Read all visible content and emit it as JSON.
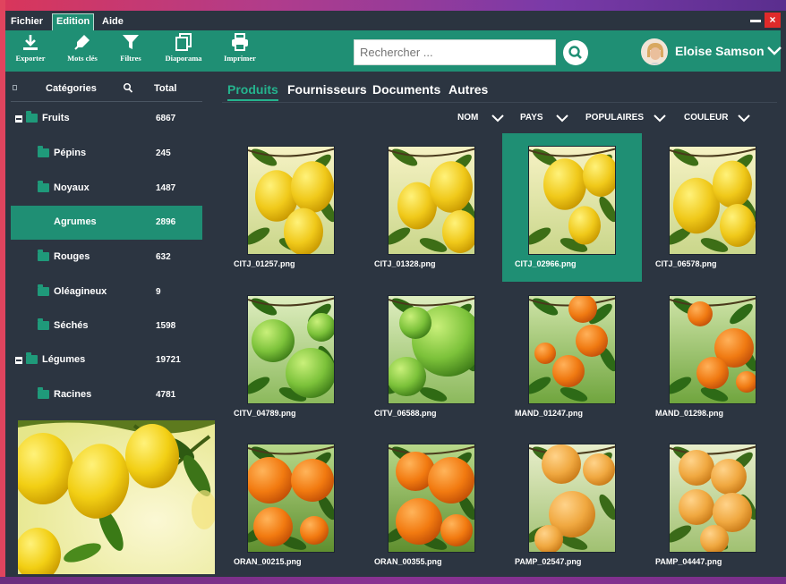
{
  "menu": {
    "items": [
      "Fichier",
      "Edition",
      "Aide"
    ],
    "active": "Edition"
  },
  "window_controls": {
    "close_glyph": "×"
  },
  "toolbar": {
    "buttons": [
      {
        "label": "Exporter",
        "icon": "download-icon"
      },
      {
        "label": "Mots clés",
        "icon": "tag-icon"
      },
      {
        "label": "Filtres",
        "icon": "filter-icon"
      },
      {
        "label": "Diaporama",
        "icon": "slideshow-icon"
      },
      {
        "label": "Imprimer",
        "icon": "printer-icon"
      }
    ]
  },
  "search": {
    "placeholder": "Rechercher ...",
    "value": ""
  },
  "user": {
    "name": "Eloise Samson"
  },
  "sidebar": {
    "header": {
      "category_label": "Catégories",
      "total_label": "Total"
    },
    "categories": [
      {
        "label": "Fruits",
        "count": "6867",
        "level": 0,
        "expanded": true
      },
      {
        "label": "Pépins",
        "count": "245",
        "level": 1
      },
      {
        "label": "Noyaux",
        "count": "1487",
        "level": 1
      },
      {
        "label": "Agrumes",
        "count": "2896",
        "level": 1,
        "selected": true
      },
      {
        "label": "Rouges",
        "count": "632",
        "level": 1
      },
      {
        "label": "Oléagineux",
        "count": "9",
        "level": 1
      },
      {
        "label": "Séchés",
        "count": "1598",
        "level": 1
      },
      {
        "label": "Légumes",
        "count": "19721",
        "level": 0,
        "expanded": true
      },
      {
        "label": "Racines",
        "count": "4781",
        "level": 1
      }
    ]
  },
  "tabs": [
    {
      "label": "Produits",
      "active": true
    },
    {
      "label": "Fournisseurs",
      "active": false
    },
    {
      "label": "Documents",
      "active": false
    },
    {
      "label": "Autres",
      "active": false
    }
  ],
  "filters": [
    {
      "label": "NOM"
    },
    {
      "label": "PAYS"
    },
    {
      "label": "POPULAIRES"
    },
    {
      "label": "COULEUR"
    }
  ],
  "gallery": [
    {
      "name": "CITJ_01257.png",
      "fruit": "lemon"
    },
    {
      "name": "CITJ_01328.png",
      "fruit": "lemon"
    },
    {
      "name": "CITJ_02966.png",
      "fruit": "lemon",
      "selected": true
    },
    {
      "name": "CITJ_06578.png",
      "fruit": "lemon"
    },
    {
      "name": "CITV_04789.png",
      "fruit": "lime"
    },
    {
      "name": "CITV_06588.png",
      "fruit": "lime"
    },
    {
      "name": "MAND_01247.png",
      "fruit": "mandarin"
    },
    {
      "name": "MAND_01298.png",
      "fruit": "mandarin"
    },
    {
      "name": "ORAN_00215.png",
      "fruit": "orange"
    },
    {
      "name": "ORAN_00355.png",
      "fruit": "orange"
    },
    {
      "name": "PAMP_02547.png",
      "fruit": "grapefruit"
    },
    {
      "name": "PAMP_04447.png",
      "fruit": "grapefruit"
    }
  ],
  "colors": {
    "accent": "#1f8f74",
    "tab_active": "#25b48e",
    "background": "#2c3541",
    "close": "#e02a2a"
  }
}
